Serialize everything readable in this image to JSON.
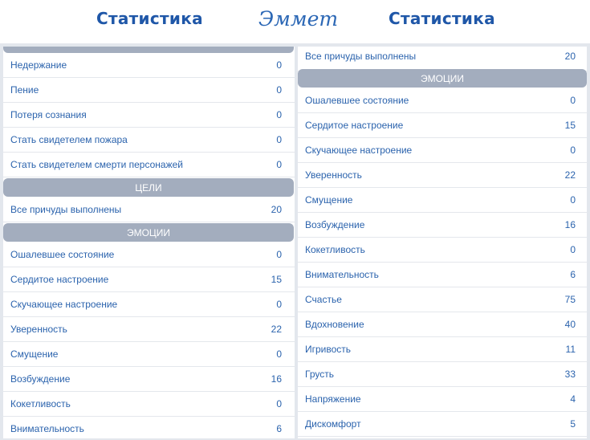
{
  "header": {
    "left_title": "Статистика",
    "right_title": "Статистика",
    "character_name": "Эммет"
  },
  "left_panel": {
    "rows_top": [
      {
        "label": "Недержание",
        "value": "0"
      },
      {
        "label": "Пение",
        "value": "0"
      },
      {
        "label": "Потеря сознания",
        "value": "0"
      },
      {
        "label": "Стать свидетелем пожара",
        "value": "0"
      },
      {
        "label": "Стать свидетелем смерти персонажей",
        "value": "0"
      }
    ],
    "goals_header": "Цели",
    "goals_rows": [
      {
        "label": "Все причуды выполнены",
        "value": "20"
      }
    ],
    "emotions_header": "Эмоции",
    "emotions_rows": [
      {
        "label": "Ошалевшее состояние",
        "value": "0"
      },
      {
        "label": "Сердитое настроение",
        "value": "15"
      },
      {
        "label": "Скучающее настроение",
        "value": "0"
      },
      {
        "label": "Уверенность",
        "value": "22"
      },
      {
        "label": "Смущение",
        "value": "0"
      },
      {
        "label": "Возбуждение",
        "value": "16"
      },
      {
        "label": "Кокетливость",
        "value": "0"
      },
      {
        "label": "Внимательность",
        "value": "6"
      }
    ]
  },
  "right_panel": {
    "rows_top": [
      {
        "label": "Все причуды выполнены",
        "value": "20"
      }
    ],
    "emotions_header": "Эмоции",
    "emotions_rows": [
      {
        "label": "Ошалевшее состояние",
        "value": "0"
      },
      {
        "label": "Сердитое настроение",
        "value": "15"
      },
      {
        "label": "Скучающее настроение",
        "value": "0"
      },
      {
        "label": "Уверенность",
        "value": "22"
      },
      {
        "label": "Смущение",
        "value": "0"
      },
      {
        "label": "Возбуждение",
        "value": "16"
      },
      {
        "label": "Кокетливость",
        "value": "0"
      },
      {
        "label": "Внимательность",
        "value": "6"
      },
      {
        "label": "Счастье",
        "value": "75"
      },
      {
        "label": "Вдохновение",
        "value": "40"
      },
      {
        "label": "Игривость",
        "value": "11"
      },
      {
        "label": "Грусть",
        "value": "33"
      },
      {
        "label": "Напряжение",
        "value": "4"
      },
      {
        "label": "Дискомфорт",
        "value": "5"
      }
    ]
  }
}
